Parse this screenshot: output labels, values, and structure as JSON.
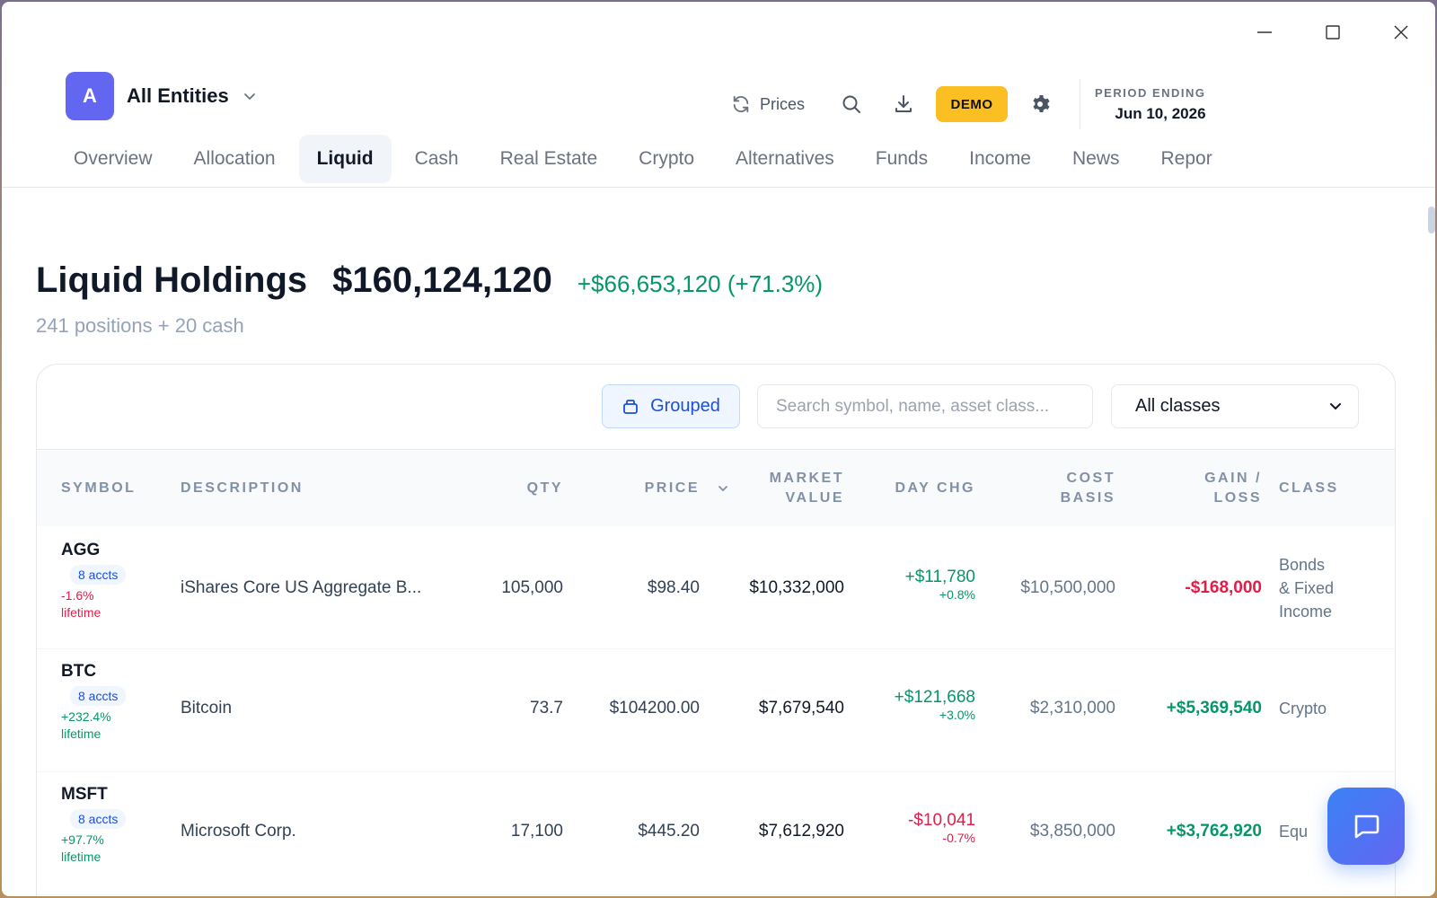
{
  "entity": {
    "avatar_letter": "A",
    "name": "All Entities"
  },
  "actions": {
    "prices_label": "Prices",
    "demo_label": "DEMO"
  },
  "period": {
    "label": "PERIOD ENDING",
    "date": "Jun 10, 2026"
  },
  "tabs": [
    "Overview",
    "Allocation",
    "Liquid",
    "Cash",
    "Real Estate",
    "Crypto",
    "Alternatives",
    "Funds",
    "Income",
    "News",
    "Repor"
  ],
  "active_tab": "Liquid",
  "summary": {
    "title": "Liquid Holdings",
    "total": "$160,124,120",
    "change": "+$66,653,120 (+71.3%)",
    "subtitle": "241 positions + 20 cash"
  },
  "toolbar": {
    "grouped_label": "Grouped",
    "search_placeholder": "Search symbol, name, asset class...",
    "class_filter": "All classes"
  },
  "table": {
    "headers": {
      "symbol": "SYMBOL",
      "description": "DESCRIPTION",
      "qty": "QTY",
      "price": "PRICE",
      "market_value_1": "MARKET",
      "market_value_2": "VALUE",
      "day_chg": "DAY CHG",
      "cost_basis_1": "COST",
      "cost_basis_2": "BASIS",
      "gain_loss_1": "GAIN /",
      "gain_loss_2": "LOSS",
      "class": "CLASS"
    },
    "rows": [
      {
        "symbol": "AGG",
        "accts": "8 accts",
        "lifetime_pct": "-1.6%",
        "lifetime_label": "lifetime",
        "description": "iShares Core US Aggregate B...",
        "qty": "105,000",
        "price": "$98.40",
        "market_value": "$10,332,000",
        "day_chg": "+$11,780",
        "day_pct": "+0.8%",
        "cost_basis": "$10,500,000",
        "gain_loss": "-$168,000",
        "class_1": "Bonds",
        "class_2": "& Fixed",
        "class_3": "Income"
      },
      {
        "symbol": "BTC",
        "accts": "8 accts",
        "lifetime_pct": "+232.4%",
        "lifetime_label": "lifetime",
        "description": "Bitcoin",
        "qty": "73.7",
        "price": "$104200.00",
        "market_value": "$7,679,540",
        "day_chg": "+$121,668",
        "day_pct": "+3.0%",
        "cost_basis": "$2,310,000",
        "gain_loss": "+$5,369,540",
        "class_1": "Crypto"
      },
      {
        "symbol": "MSFT",
        "accts": "8 accts",
        "lifetime_pct": "+97.7%",
        "lifetime_label": "lifetime",
        "description": "Microsoft Corp.",
        "qty": "17,100",
        "price": "$445.20",
        "market_value": "$7,612,920",
        "day_chg": "-$10,041",
        "day_pct": "-0.7%",
        "cost_basis": "$3,850,000",
        "gain_loss": "+$3,762,920",
        "class_1": "Equ"
      }
    ]
  },
  "colors": {
    "accent": "#6366f1",
    "positive": "#059669",
    "negative": "#e11d48",
    "demo": "#fbbf24"
  }
}
